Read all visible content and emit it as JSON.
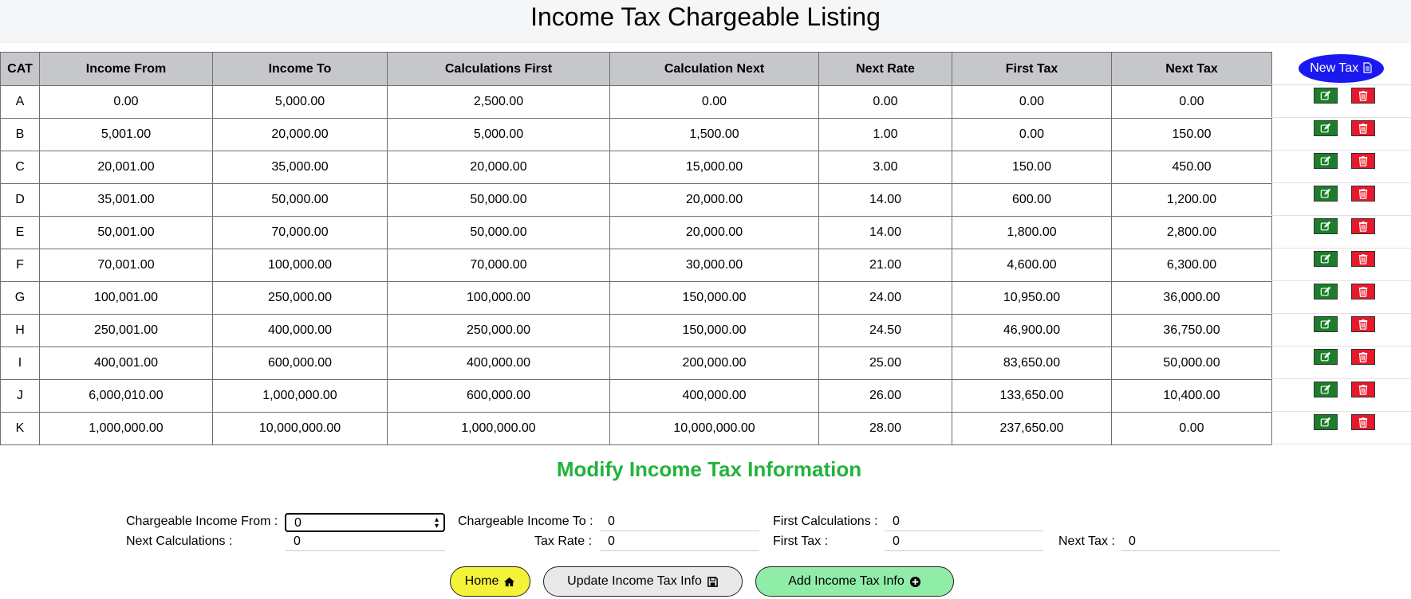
{
  "page_title": "Income Tax Chargeable Listing",
  "table": {
    "headers": [
      "CAT",
      "Income From",
      "Income To",
      "Calculations First",
      "Calculation Next",
      "Next Rate",
      "First Tax",
      "Next Tax"
    ],
    "rows": [
      [
        "A",
        "0.00",
        "5,000.00",
        "2,500.00",
        "0.00",
        "0.00",
        "0.00",
        "0.00"
      ],
      [
        "B",
        "5,001.00",
        "20,000.00",
        "5,000.00",
        "1,500.00",
        "1.00",
        "0.00",
        "150.00"
      ],
      [
        "C",
        "20,001.00",
        "35,000.00",
        "20,000.00",
        "15,000.00",
        "3.00",
        "150.00",
        "450.00"
      ],
      [
        "D",
        "35,001.00",
        "50,000.00",
        "50,000.00",
        "20,000.00",
        "14.00",
        "600.00",
        "1,200.00"
      ],
      [
        "E",
        "50,001.00",
        "70,000.00",
        "50,000.00",
        "20,000.00",
        "14.00",
        "1,800.00",
        "2,800.00"
      ],
      [
        "F",
        "70,001.00",
        "100,000.00",
        "70,000.00",
        "30,000.00",
        "21.00",
        "4,600.00",
        "6,300.00"
      ],
      [
        "G",
        "100,001.00",
        "250,000.00",
        "100,000.00",
        "150,000.00",
        "24.00",
        "10,950.00",
        "36,000.00"
      ],
      [
        "H",
        "250,001.00",
        "400,000.00",
        "250,000.00",
        "150,000.00",
        "24.50",
        "46,900.00",
        "36,750.00"
      ],
      [
        "I",
        "400,001.00",
        "600,000.00",
        "400,000.00",
        "200,000.00",
        "25.00",
        "83,650.00",
        "50,000.00"
      ],
      [
        "J",
        "6,000,010.00",
        "1,000,000.00",
        "600,000.00",
        "400,000.00",
        "26.00",
        "133,650.00",
        "10,400.00"
      ],
      [
        "K",
        "1,000,000.00",
        "10,000,000.00",
        "1,000,000.00",
        "10,000,000.00",
        "28.00",
        "237,650.00",
        "0.00"
      ]
    ]
  },
  "new_tax_label": "New Tax",
  "row_actions": {
    "edit_icon": "edit-icon",
    "delete_icon": "trash-icon",
    "edit_color": "#1c7d2a",
    "delete_color": "#e8182b"
  },
  "modify_title": "Modify Income Tax Information",
  "form": {
    "chargeable_income_from_label": "Chargeable Income From :",
    "chargeable_income_from_value": "0",
    "chargeable_income_to_label": "Chargeable Income To :",
    "chargeable_income_to_value": "0",
    "first_calculations_label": "First Calculations :",
    "first_calculations_value": "0",
    "next_calculations_label": "Next Calculations :",
    "next_calculations_value": "0",
    "tax_rate_label": "Tax Rate :",
    "tax_rate_value": "0",
    "first_tax_label": "First Tax :",
    "first_tax_value": "0",
    "next_tax_label": "Next Tax :",
    "next_tax_value": "0"
  },
  "buttons": {
    "home": "Home",
    "update": "Update Income Tax Info",
    "add": "Add Income Tax Info"
  },
  "colors": {
    "accent_blue": "#1a1af0",
    "title_green": "#22b33c",
    "home_yellow": "#f5f23a",
    "add_green": "#90eda8"
  }
}
